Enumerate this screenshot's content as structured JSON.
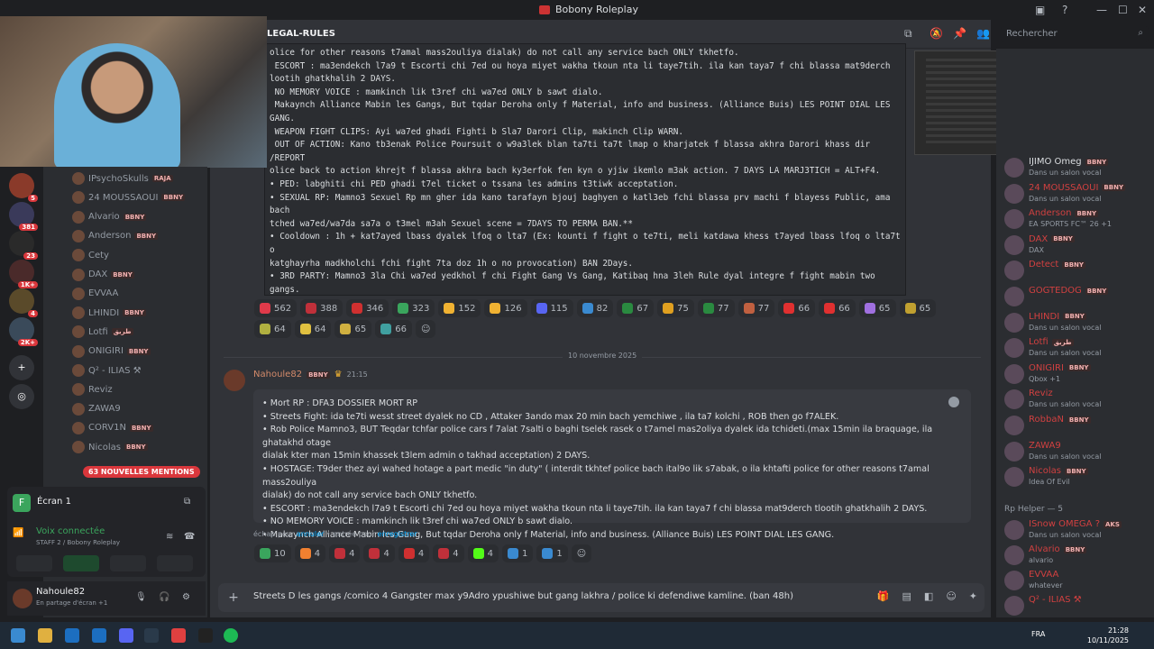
{
  "window": {
    "title": "Bobony Roleplay",
    "minimize": "—",
    "maximize": "☐",
    "close": "✕"
  },
  "channel": {
    "name": "LEGAL-RULES"
  },
  "search": {
    "placeholder": "Rechercher"
  },
  "rules_block": {
    "lines": [
      "olice for other reasons t7amal mass2ouliya dialak) do not call any service bach ONLY tkhetfo.",
      " ESCORT : ma3endekch l7a9 t Escorti chi 7ed ou hoya miyet wakha tkoun nta li taye7tih. ila kan taya7 f chi blassa mat9derch",
      "lootih ghatkhalih 2 DAYS.",
      " NO MEMORY VOICE : mamkinch lik t3ref chi wa7ed ONLY b sawt dialo.",
      " Makaynch Alliance Mabin les Gangs, But tqdar Deroha only f Material, info and business. (Alliance Buis) LES POINT DIAL LES",
      "GANG.",
      " WEAPON FIGHT CLIPS: Ayi wa7ed ghadi Fighti b Sla7 Darori Clip, makinch Clip WARN.",
      " OUT OF ACTION: Kano tb3enak Police Poursuit o w9a3lek blan ta7ti ta7t lmap o kharjatek f blassa akhra Darori khass dir /REPORT",
      "olice back to action khrejt f blassa akhra bach ky3erfok fen kyn o yjiw ikemlo m3ak action. 7 DAYS LA MARJ3TICH = ALT+F4.",
      "• PED: labghiti chi PED ghadi t7el ticket o tssana les admins t3tiwk acceptation.",
      "• SEXUAL RP: Mamno3 Sexuel Rp mn gher ida kano tarafayn bjouj baghyen o katl3eb fchi blassa prv machi f blayess Public, ama bach",
      "tched wa7ed/wa7da sa7a o t3mel m3ah Sexuel scene = 7DAYS TO PERMA BAN.**",
      "• Cooldown : 1h + kat7ayed lbass dyalek lfoq o lta7 (Ex: kounti f fight o te7ti, meli katdawa khess t7ayed lbass lfoq o lta7t o",
      "katghayrha madkholchi fchi fight 7ta doz 1h o no provocation) BAN 2Days.",
      "• 3RD PARTY: Mamno3 3la Chi wa7ed yedkhol f chi Fight Gang Vs Gang, Katibaq hna 3leh Rule dyal integre f fight mabin two gangs.",
      "(civils or other gang members) 2 DAYS.",
      "• Gangs COLOR: interdit tlbass chi loune dial chi gang bach tchawah lihoum som3a, interdit tbadal loune dialak bach threb man chi",
      "war. POINT DIAL LES GANGS.",
      "• Shop Robbery: khassek darori tssana 10 min, ila majawch police dik sa3a imken lik tmchi 2 DAYS."
    ]
  },
  "reactions_row1": [
    {
      "emoji": "heart",
      "color": "#e03a4a",
      "count": "562"
    },
    {
      "emoji": "red-car",
      "color": "#c0303a",
      "count": "388"
    },
    {
      "emoji": "red-flag",
      "color": "#d03030",
      "count": "346"
    },
    {
      "emoji": "check",
      "color": "#3aa55d",
      "count": "323"
    },
    {
      "emoji": "smile",
      "color": "#f0b232",
      "count": "152"
    },
    {
      "emoji": "thumbsup",
      "color": "#f0b232",
      "count": "126"
    },
    {
      "emoji": "badge",
      "color": "#5865f2",
      "count": "115"
    },
    {
      "emoji": "tile",
      "color": "#3a8ad0",
      "count": "82"
    },
    {
      "emoji": "flag-green",
      "color": "#2a8a40",
      "count": "67"
    },
    {
      "emoji": "flag-es",
      "color": "#e0a020",
      "count": "75"
    },
    {
      "emoji": "flag-ps",
      "color": "#2a8a40",
      "count": "77"
    },
    {
      "emoji": "person",
      "color": "#c06040",
      "count": "77"
    },
    {
      "emoji": "flag-tn",
      "color": "#e03030",
      "count": "66"
    },
    {
      "emoji": "pin",
      "color": "#e03030",
      "count": "66"
    },
    {
      "emoji": "rocket",
      "color": "#a070e0",
      "count": "65"
    },
    {
      "emoji": "coin",
      "color": "#c0a030",
      "count": "65"
    }
  ],
  "reactions_row2": [
    {
      "emoji": "R",
      "color": "#b0b040",
      "count": "64"
    },
    {
      "emoji": "bolt",
      "color": "#e0c040",
      "count": "64"
    },
    {
      "emoji": "N",
      "color": "#d0b040",
      "count": "65"
    },
    {
      "emoji": "cycle",
      "color": "#40a0a0",
      "count": "66"
    }
  ],
  "date_divider": "10 novembre 2025",
  "message": {
    "author": "Nahoule82",
    "tag": "BBNY",
    "time": "21:15",
    "lines": [
      "• Mort RP : DFA3 DOSSIER MORT RP",
      "• Streets Fight: ida te7ti wesst street dyalek no CD , Attaker 3ando max 20 min bach yemchiwe , ila ta7 kolchi , ROB then go f7ALEK.",
      "• Rob Police Mamno3, BUT Teqdar tchfar police cars f 7alat 7salti o baghi tselek rasek o t7amel mas2oliya dyalek ida tchideti.(max 15min ila braquage, ila ghatakhd otage",
      "dialak kter man 15min khassek t3lem admin o takhad acceptation) 2 DAYS.",
      "• HOSTAGE: T9der thez ayi wahed hotage a part medic \"in duty\" ( interdit tkhtef police bach ital9o lik s7abak, o ila khtafti police for other reasons t7amal mass2ouliya",
      "dialak) do not call any service bach ONLY tkhetfo.",
      "• ESCORT : ma3endekch l7a9 t Escorti chi 7ed ou hoya miyet wakha tkoun nta li taye7tih. ila kan taya7 f chi blassa mat9derch tlootih ghatkhalih 2 DAYS.",
      "• NO MEMORY VOICE : mamkinch lik t3ref chi wa7ed ONLY b sawt dialo.",
      "• Makaynch Alliance Mabin les Gang, But tqdar Deroha only f Material, info and business. (Alliance Buis) LES POINT DIAL LES GANG."
    ]
  },
  "edit_hint": {
    "escape": "échap pour",
    "cancel": "annuler",
    "sep": " • entrée pour",
    "save": "enregistrer"
  },
  "edit_reactions": [
    {
      "emoji": "check",
      "color": "#3aa55d",
      "count": "10"
    },
    {
      "emoji": "fire",
      "color": "#f08030",
      "count": "4"
    },
    {
      "emoji": "red-car",
      "color": "#c0303a",
      "count": "4"
    },
    {
      "emoji": "red-car2",
      "color": "#c0303a",
      "count": "4"
    },
    {
      "emoji": "red-flag",
      "color": "#d03030",
      "count": "4"
    },
    {
      "emoji": "red-car3",
      "color": "#c0303a",
      "count": "4"
    },
    {
      "emoji": "kick",
      "color": "#53fc18",
      "count": "4"
    },
    {
      "emoji": "verified",
      "color": "#3a8ad0",
      "count": "1"
    },
    {
      "emoji": "verified2",
      "color": "#3a8ad0",
      "count": "1"
    }
  ],
  "composer": {
    "text": "Streets D les gangs /comico  4 Gangster max y9Adro ypushiwe  but gang lakhra / police ki defendiwe kamline.  (ban 48h)"
  },
  "sidebar_voice_users": [
    {
      "name": "IPsychoSkulls",
      "tag": "RAJA"
    },
    {
      "name": "24 MOUSSAOUI",
      "tag": "BBNY"
    },
    {
      "name": "Alvario",
      "tag": "BBNY"
    },
    {
      "name": "Anderson",
      "tag": "BBNY"
    },
    {
      "name": "Cety",
      "tag": ""
    },
    {
      "name": "DAX",
      "tag": "BBNY"
    },
    {
      "name": "EVVAA",
      "tag": ""
    },
    {
      "name": "LHINDI",
      "tag": "BBNY"
    },
    {
      "name": "Lotfi",
      "tag": "طريق"
    },
    {
      "name": "ONIGIRI",
      "tag": "BBNY"
    },
    {
      "name": "Q² - ILIAS ⚒",
      "tag": ""
    },
    {
      "name": "Reviz",
      "tag": ""
    },
    {
      "name": "ZAWA9",
      "tag": ""
    },
    {
      "name": "CORV1N",
      "tag": "BBNY"
    },
    {
      "name": "Nicolas",
      "tag": "BBNY"
    }
  ],
  "new_mentions": "63 NOUVELLES MENTIONS",
  "server_badges": [
    "5",
    "381",
    "23",
    "1K+",
    "4",
    "2K+"
  ],
  "screen_share": {
    "title": "Écran 1",
    "status": "Voix connectée",
    "location": "STAFF 2 / Bobony Roleplay"
  },
  "user_panel": {
    "name": "Nahoule82",
    "status": "En partage d'écran +1"
  },
  "members": [
    {
      "name": "IJIMO Omeg",
      "tag": "BBNY",
      "status": "Dans un salon vocal",
      "color": "#dbdee1"
    },
    {
      "name": "24 MOUSSAOUI",
      "tag": "BBNY",
      "status": "Dans un salon vocal",
      "color": "#d04040"
    },
    {
      "name": "Anderson",
      "tag": "BBNY",
      "status": "EA SPORTS FC™ 26 +1",
      "color": "#d04040"
    },
    {
      "name": "DAX",
      "tag": "BBNY",
      "status": "DAX",
      "color": "#d04040"
    },
    {
      "name": "Detect",
      "tag": "BBNY",
      "status": "",
      "color": "#d04040"
    },
    {
      "name": "GOGTEDOG",
      "tag": "BBNY",
      "status": "",
      "color": "#d04040"
    },
    {
      "name": "LHINDI",
      "tag": "BBNY",
      "status": "Dans un salon vocal",
      "color": "#d04040"
    },
    {
      "name": "Lotfi",
      "tag": "طريق",
      "status": "Dans un salon vocal",
      "color": "#d04040"
    },
    {
      "name": "ONIGIRI",
      "tag": "BBNY",
      "status": "Qbox +1",
      "color": "#d04040"
    },
    {
      "name": "Reviz",
      "tag": "",
      "status": "Dans un salon vocal",
      "color": "#d04040"
    },
    {
      "name": "RobbaN",
      "tag": "BBNY",
      "status": "",
      "color": "#d04040"
    },
    {
      "name": "ZAWA9",
      "tag": "",
      "status": "Dans un salon vocal",
      "color": "#d04040"
    },
    {
      "name": "Nicolas",
      "tag": "BBNY",
      "status": "Idea Of Evil",
      "color": "#d04040"
    }
  ],
  "rp_helper": {
    "header": "Rp Helper — 5"
  },
  "rp_members": [
    {
      "name": "ISnow OMEGA ?",
      "tag": "AKS",
      "status": "Dans un salon vocal",
      "color": "#d04040"
    },
    {
      "name": "Alvario",
      "tag": "BBNY",
      "status": "alvario",
      "color": "#d04040"
    },
    {
      "name": "EVVAA",
      "tag": "",
      "status": "whatever",
      "color": "#d04040"
    },
    {
      "name": "Q² - ILIAS ⚒",
      "tag": "",
      "status": "",
      "color": "#d04040"
    }
  ],
  "taskbar": {
    "lang": "FRA",
    "time": "21:28",
    "date": "10/11/2025"
  }
}
